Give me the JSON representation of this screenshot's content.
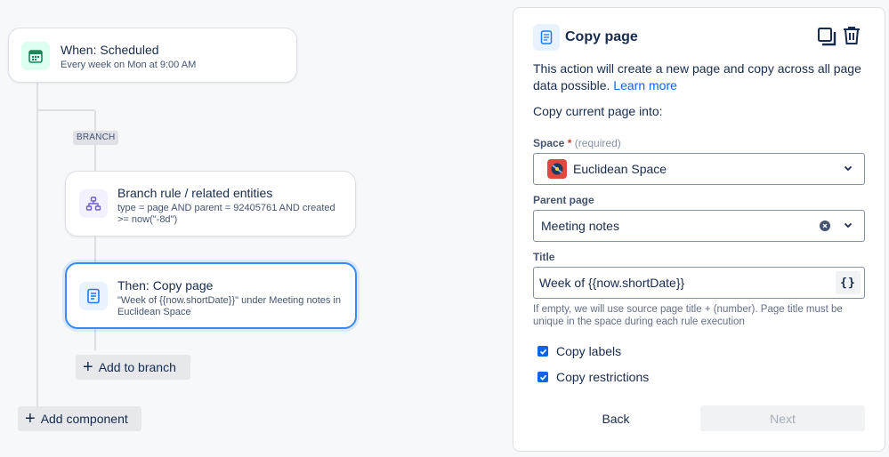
{
  "trigger": {
    "title": "When: Scheduled",
    "subtitle": "Every week on Mon at 9:00 AM",
    "icon": "calendar-icon",
    "color": "#1f845a"
  },
  "branch_tag": "BRANCH",
  "branch_rule": {
    "title": "Branch rule / related entities",
    "subtitle_line1": "type = page AND parent = 92405761 AND created",
    "subtitle_line2": ">= now(\"-8d\")",
    "icon": "hierarchy-icon",
    "color": "#6e5dc6"
  },
  "action": {
    "title": "Then: Copy page",
    "subtitle_line1": "\"Week of {{now.shortDate}}\" under Meeting notes in",
    "subtitle_line2": "Euclidean Space",
    "icon": "page-icon",
    "color": "#1d7afc"
  },
  "add_to_branch": "Add to branch",
  "add_component": "Add component",
  "panel": {
    "title": "Copy page",
    "description": "This action will create a new page and copy across all page data possible.",
    "learn_more": "Learn more",
    "copy_into": "Copy current page into:",
    "space_label": "Space",
    "required_star": "*",
    "required_note": "(required)",
    "space_value": "Euclidean Space",
    "parent_label": "Parent page",
    "parent_value": "Meeting notes",
    "title_label": "Title",
    "title_value": "Week of {{now.shortDate}}",
    "smart_value_button": "{}",
    "helper_text": "If empty, we will use source page title + (number). Page title must be unique in the space during each rule execution",
    "copy_labels": "Copy labels",
    "copy_restrictions": "Copy restrictions",
    "back_label": "Back",
    "next_label": "Next"
  },
  "colors": {
    "accent": "#0c66e4",
    "selected_border": "#388bff"
  }
}
